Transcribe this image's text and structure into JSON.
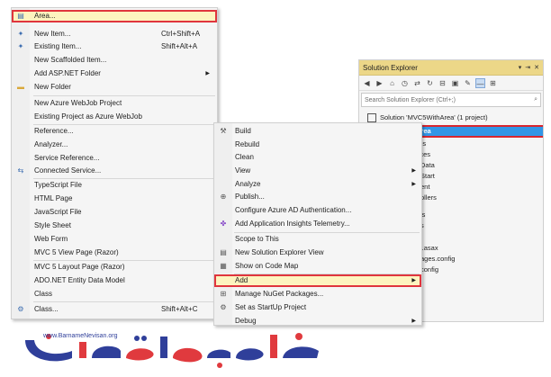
{
  "solution_explorer": {
    "title": "Solution Explorer",
    "title_controls": [
      "▾",
      "⇥",
      "✕"
    ],
    "search_placeholder": "Search Solution Explorer (Ctrl+;)",
    "search_icon": "search-icon",
    "solution_label": "Solution 'MVC5WithArea' (1 project)",
    "project_label": "MVC5WithArea",
    "tree_fragments": [
      "rties",
      "ences",
      "Data",
      "Start",
      "ent",
      "ollers",
      "ls",
      "s",
      "l.asax",
      "ages.config",
      "config"
    ]
  },
  "add_submenu": [
    {
      "label": "Area...",
      "shortcut": "",
      "icon": "area-icon",
      "highlight": true
    },
    {
      "label": "New Item...",
      "shortcut": "Ctrl+Shift+A",
      "icon": "new-item-icon"
    },
    {
      "label": "Existing Item...",
      "shortcut": "Shift+Alt+A",
      "icon": "existing-item-icon"
    },
    {
      "label": "New Scaffolded Item...",
      "shortcut": ""
    },
    {
      "label": "Add ASP.NET Folder",
      "shortcut": "",
      "submenu": true
    },
    {
      "label": "New Folder",
      "shortcut": "",
      "icon": "folder-icon"
    },
    {
      "label": "New Azure WebJob Project",
      "shortcut": ""
    },
    {
      "label": "Existing Project as Azure WebJob",
      "shortcut": ""
    },
    {
      "label": "Reference...",
      "shortcut": ""
    },
    {
      "label": "Analyzer...",
      "shortcut": ""
    },
    {
      "label": "Service Reference...",
      "shortcut": ""
    },
    {
      "label": "Connected Service...",
      "shortcut": "",
      "icon": "connected-service-icon"
    },
    {
      "label": "TypeScript File",
      "shortcut": ""
    },
    {
      "label": "HTML Page",
      "shortcut": ""
    },
    {
      "label": "JavaScript File",
      "shortcut": ""
    },
    {
      "label": "Style Sheet",
      "shortcut": ""
    },
    {
      "label": "Web Form",
      "shortcut": ""
    },
    {
      "label": "MVC 5 View Page (Razor)",
      "shortcut": ""
    },
    {
      "label": "MVC 5 Layout Page (Razor)",
      "shortcut": ""
    },
    {
      "label": "ADO.NET Entity Data Model",
      "shortcut": ""
    },
    {
      "label": "Class",
      "shortcut": ""
    },
    {
      "label": "Class...",
      "shortcut": "Shift+Alt+C",
      "icon": "class-icon"
    }
  ],
  "context_menu": [
    {
      "label": "Build",
      "icon": "build-icon"
    },
    {
      "label": "Rebuild"
    },
    {
      "label": "Clean"
    },
    {
      "label": "View",
      "submenu": true
    },
    {
      "label": "Analyze",
      "submenu": true
    },
    {
      "label": "Publish...",
      "icon": "publish-icon"
    },
    {
      "label": "Configure Azure AD Authentication..."
    },
    {
      "label": "Add Application Insights Telemetry...",
      "icon": "insights-icon"
    },
    {
      "label": "Scope to This"
    },
    {
      "label": "New Solution Explorer View",
      "icon": "new-view-icon"
    },
    {
      "label": "Show on Code Map",
      "icon": "code-map-icon"
    },
    {
      "label": "Add",
      "submenu": true,
      "highlight": true
    },
    {
      "label": "Manage NuGet Packages...",
      "icon": "nuget-icon"
    },
    {
      "label": "Set as StartUp Project",
      "icon": "gear-icon"
    },
    {
      "label": "Debug",
      "submenu": true
    }
  ],
  "logo": {
    "url": "www.BarnameNevisan.org",
    "brand": "برنامه نویسان"
  },
  "colors": {
    "highlight_border": "#e0353d",
    "highlight_fill": "#fdf4bf",
    "selection_blue": "#3296e6",
    "title_bar": "#ecd788",
    "logo_blue": "#2f3f9a",
    "logo_red": "#e03a3e"
  }
}
